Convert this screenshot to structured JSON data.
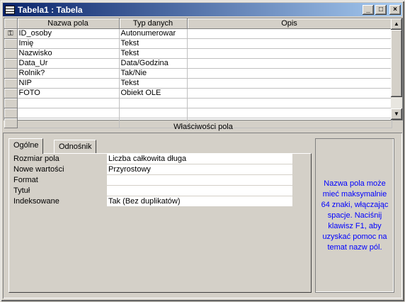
{
  "window": {
    "title": "Tabela1 : Tabela",
    "controls": [
      "minimize",
      "maximize",
      "close"
    ]
  },
  "grid": {
    "columns": [
      "Nazwa pola",
      "Typ danych",
      "Opis"
    ],
    "rows": [
      {
        "name": "ID_osoby",
        "type": "Autonumerowar",
        "desc": "",
        "key": true
      },
      {
        "name": "Imię",
        "type": "Tekst",
        "desc": "",
        "key": false
      },
      {
        "name": "Nazwisko",
        "type": "Tekst",
        "desc": "",
        "key": false
      },
      {
        "name": "Data_Ur",
        "type": "Data/Godzina",
        "desc": "",
        "key": false
      },
      {
        "name": "Rolnik?",
        "type": "Tak/Nie",
        "desc": "",
        "key": false
      },
      {
        "name": "NIP",
        "type": "Tekst",
        "desc": "",
        "key": false
      },
      {
        "name": "FOTO",
        "type": "Obiekt OLE",
        "desc": "",
        "key": false
      },
      {
        "name": "",
        "type": "",
        "desc": "",
        "key": false
      },
      {
        "name": "",
        "type": "",
        "desc": "",
        "key": false
      },
      {
        "name": "",
        "type": "",
        "desc": "",
        "key": false
      }
    ]
  },
  "properties": {
    "section_label": "Właściwości pola",
    "tabs": [
      "Ogólne",
      "Odnośnik"
    ],
    "active_tab": "Ogólne",
    "items": [
      {
        "label": "Rozmiar pola",
        "value": "Liczba całkowita długa"
      },
      {
        "label": "Nowe wartości",
        "value": "Przyrostowy"
      },
      {
        "label": "Format",
        "value": ""
      },
      {
        "label": "Tytuł",
        "value": ""
      },
      {
        "label": "Indeksowane",
        "value": "Tak (Bez duplikatów)"
      }
    ],
    "help": "Nazwa pola może mieć maksymalnie 64 znaki, włączając spacje. Naciśnij klawisz F1, aby uzyskać pomoc na temat nazw pól."
  },
  "icons": {
    "title": "table-icon",
    "key": "primary-key-icon",
    "scroll_up": "arrow-up-icon",
    "scroll_down": "arrow-down-icon"
  },
  "colors": {
    "title_gradient_start": "#0a246a",
    "title_gradient_end": "#a6caf0",
    "help_text": "#0000ff",
    "face": "#d4d0c8"
  }
}
